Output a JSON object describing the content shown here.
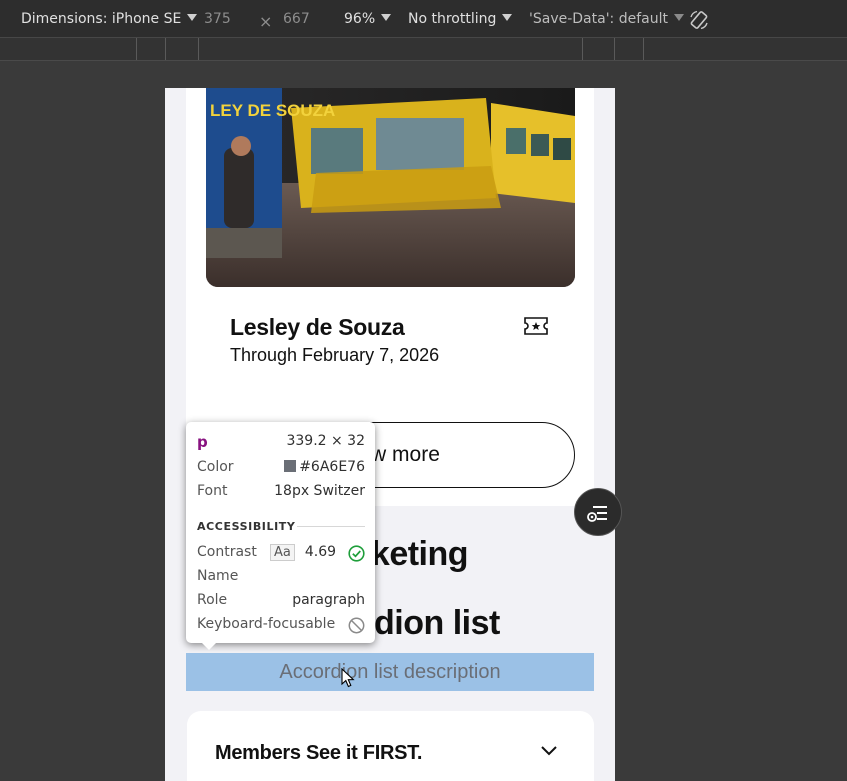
{
  "toolbar": {
    "dimensions_label": "Dimensions: iPhone SE",
    "width": "375",
    "times": "×",
    "height": "667",
    "zoom": "96%",
    "throttling": "No throttling",
    "save_data": "'Save-Data': default",
    "rotate_icon": "rotate-icon"
  },
  "page": {
    "card_title": "Lesley de Souza",
    "card_date": "Through February 7, 2026",
    "view_more": "View more",
    "heading_marketing": "Marketing",
    "heading_accordion": "Accordion list",
    "description": "Accordion list description",
    "accordion_items": [
      {
        "label": "Members See it FIRST."
      }
    ],
    "hero_sign_text": "LEY DE SOUZA"
  },
  "tooltip": {
    "tag": "p",
    "size": "339.2 × 32",
    "color_label": "Color",
    "color_value": "#6A6E76",
    "font_label": "Font",
    "font_value": "18px Switzer",
    "section": "ACCESSIBILITY",
    "contrast_label": "Contrast",
    "contrast_aa": "Aa",
    "contrast_value": "4.69",
    "name_label": "Name",
    "role_label": "Role",
    "role_value": "paragraph",
    "focus_label": "Keyboard-focusable"
  },
  "colors": {
    "highlight": "#9bc1e6",
    "text_gray": "#6A6E76",
    "tag_purple": "#881280",
    "pass_green": "#1e9e3a"
  }
}
